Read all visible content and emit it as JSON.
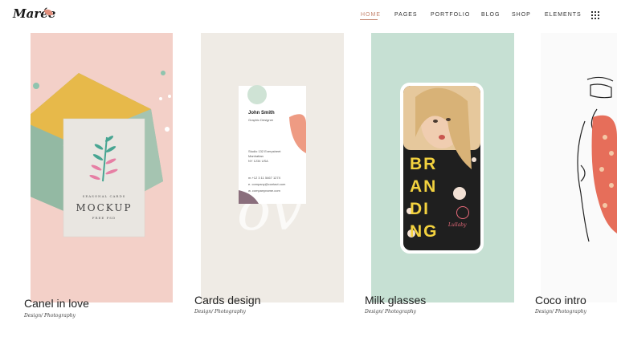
{
  "brand": {
    "name": "Marée"
  },
  "nav": {
    "items": [
      {
        "label": "HOME",
        "active": true
      },
      {
        "label": "PAGES"
      },
      {
        "label": "PORTFOLIO"
      },
      {
        "label": "BLOG"
      },
      {
        "label": "SHOP"
      },
      {
        "label": "ELEMENTS"
      }
    ],
    "menu_icon": "grid-menu-icon"
  },
  "cards": [
    {
      "title": "Canel in love",
      "category": "Design/ Photography",
      "bg": "#f3d0c8",
      "mockup": {
        "line1": "SEASONAL CARDS",
        "line2": "MOCKUP",
        "line3": "FREE PSD"
      }
    },
    {
      "title": "Cards design",
      "category": "Design/ Photography",
      "bg": "#efebe5",
      "bizcard": {
        "name": "John Smith",
        "role": "Graphic Designer",
        "addr1": "Studio 132 Everystreet",
        "addr2": "Manhattan",
        "addr3": "NY 1234 USA",
        "phone": "m.+12 3 11 5467 127X",
        "email": "e. company@contact.com",
        "web": "w. companyname.com"
      }
    },
    {
      "title": "Milk glasses",
      "category": "Design/ Photography",
      "bg": "#c6e0d3",
      "phone": {
        "line1": "BR",
        "line2": "AN",
        "line3": "DI",
        "line4": "NG",
        "tag": "Lullaby"
      }
    },
    {
      "title": "Coco intro",
      "category": "Design/ Photography",
      "bg": "#fafafa"
    }
  ]
}
